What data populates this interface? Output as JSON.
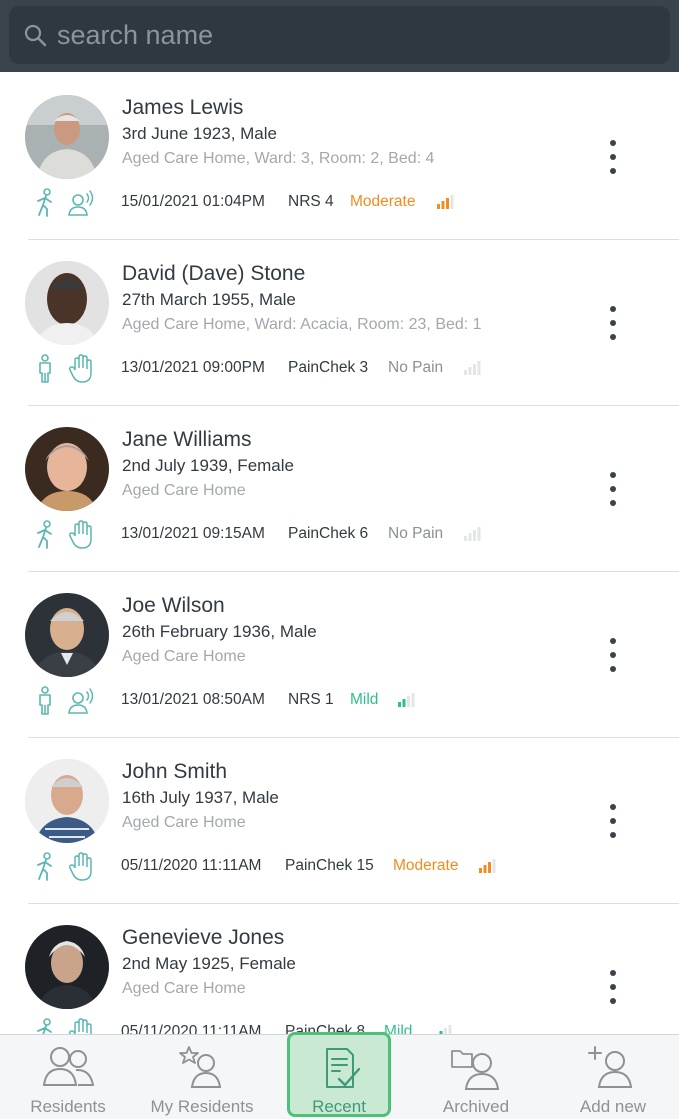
{
  "search": {
    "placeholder": "search name"
  },
  "colors": {
    "moderate": "#f28c1e",
    "mild": "#2fbf8a",
    "no_pain": "#8a9097",
    "icon_teal": "#5bb7b3"
  },
  "residents": [
    {
      "name": "James Lewis",
      "dob": "3rd June 1923, Male",
      "location": "Aged Care Home, Ward: 3, Room: 2, Bed: 4",
      "icons": [
        "walking-person-icon",
        "speaking-person-icon"
      ],
      "date": "15/01/2021 01:04PM",
      "score": "NRS 4",
      "level": "Moderate",
      "level_type": "moderate",
      "level_bars": 3
    },
    {
      "name": "David (Dave) Stone",
      "dob": "27th March 1955, Male",
      "location": "Aged Care Home, Ward: Acacia, Room: 23, Bed: 1",
      "icons": [
        "standing-person-icon",
        "hand-icon"
      ],
      "date": "13/01/2021 09:00PM",
      "score": "PainChek 3",
      "level": "No Pain",
      "level_type": "no_pain",
      "level_bars": 0
    },
    {
      "name": "Jane Williams",
      "dob": "2nd July 1939, Female",
      "location": "Aged Care Home",
      "icons": [
        "walking-person-icon",
        "hand-icon"
      ],
      "date": "13/01/2021 09:15AM",
      "score": "PainChek 6",
      "level": "No Pain",
      "level_type": "no_pain",
      "level_bars": 0
    },
    {
      "name": "Joe Wilson",
      "dob": "26th February 1936, Male",
      "location": "Aged Care Home",
      "icons": [
        "standing-person-icon",
        "speaking-person-icon"
      ],
      "date": "13/01/2021 08:50AM",
      "score": "NRS 1",
      "level": "Mild",
      "level_type": "mild",
      "level_bars": 2
    },
    {
      "name": "John Smith",
      "dob": "16th July 1937, Male",
      "location": "Aged Care Home",
      "icons": [
        "walking-person-icon",
        "hand-icon"
      ],
      "date": "05/11/2020 11:11AM",
      "score": "PainChek 15",
      "level": "Moderate",
      "level_type": "moderate",
      "level_bars": 3
    },
    {
      "name": "Genevieve Jones",
      "dob": "2nd May 1925, Female",
      "location": "Aged Care Home",
      "icons": [
        "walking-person-icon",
        "hand-icon"
      ],
      "date": "05/11/2020 11:11AM",
      "score": "PainChek 8",
      "level": "Mild",
      "level_type": "mild",
      "level_bars": 2
    }
  ],
  "tabs": [
    {
      "label": "Residents",
      "icon": "residents-icon",
      "active": false
    },
    {
      "label": "My Residents",
      "icon": "my-residents-icon",
      "active": false
    },
    {
      "label": "Recent",
      "icon": "recent-icon",
      "active": true
    },
    {
      "label": "Archived",
      "icon": "archived-icon",
      "active": false
    },
    {
      "label": "Add new",
      "icon": "add-new-icon",
      "active": false
    }
  ]
}
